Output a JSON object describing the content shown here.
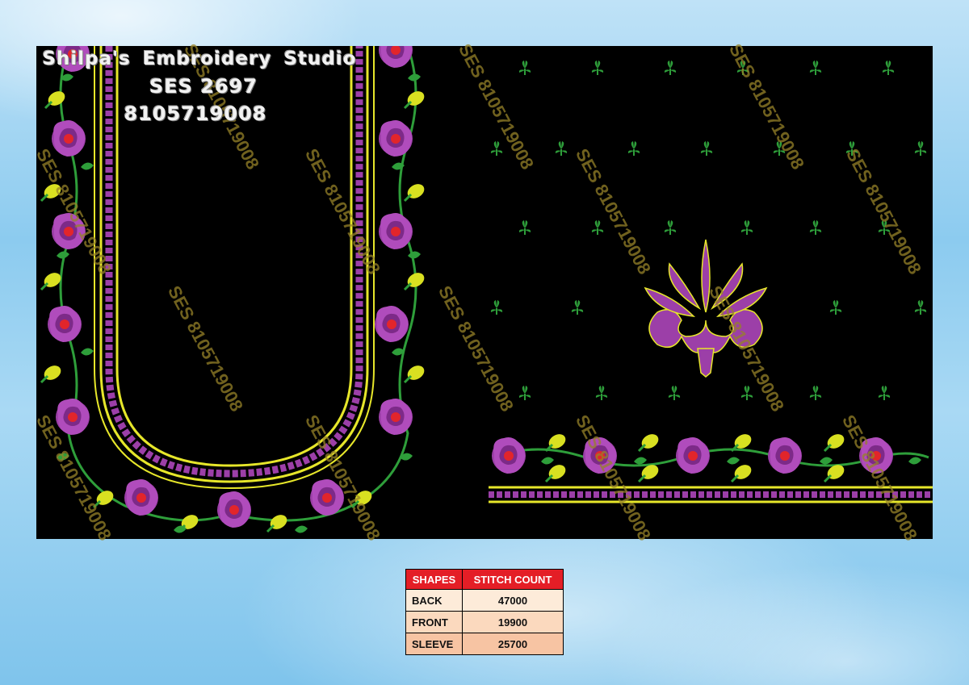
{
  "studio": {
    "name": "Shilpa's Embroidery Studio",
    "design_code": "SES 2697",
    "phone": "8105719008"
  },
  "watermark_text": "SES 8105719008",
  "colors": {
    "background": "#000000",
    "rose": "#9c3fa8",
    "rose_center": "#e2252b",
    "leaf": "#2e9e3a",
    "bud": "#d9e021",
    "border_yellow": "#e6e62a",
    "table_header": "#e41e26"
  },
  "stitch_table": {
    "headers": [
      "SHAPES",
      "STITCH COUNT"
    ],
    "rows": [
      {
        "shape": "BACK",
        "count": "47000"
      },
      {
        "shape": "FRONT",
        "count": "19900"
      },
      {
        "shape": "SLEEVE",
        "count": "25700"
      }
    ]
  }
}
